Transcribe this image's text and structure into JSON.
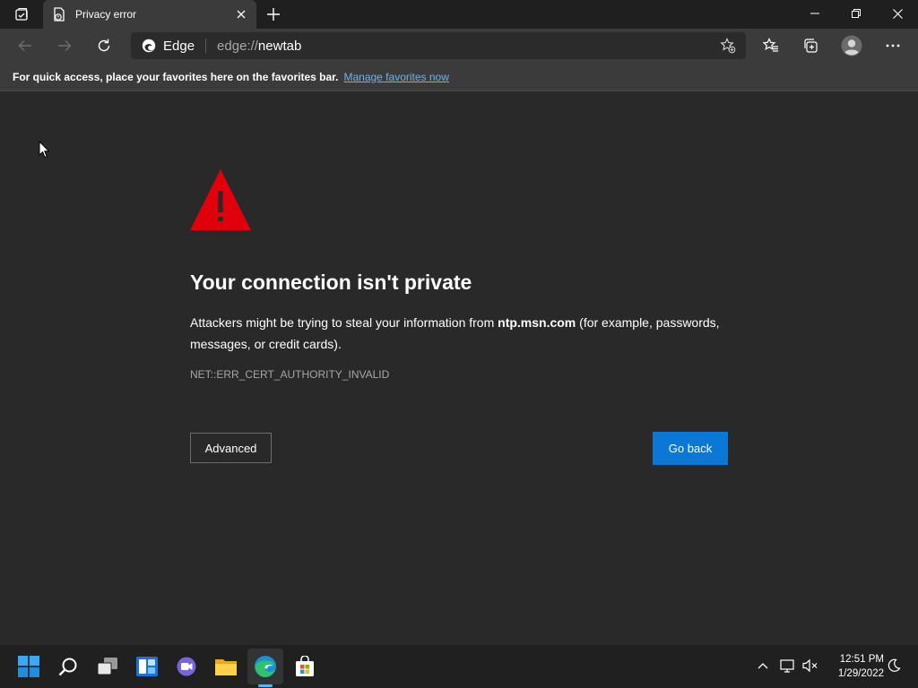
{
  "tab": {
    "title": "Privacy error"
  },
  "address": {
    "brand": "Edge",
    "scheme": "edge://",
    "host": "newtab"
  },
  "favorites_bar": {
    "message": "For quick access, place your favorites here on the favorites bar.",
    "link_label": "Manage favorites now"
  },
  "page": {
    "heading": "Your connection isn't private",
    "desc_prefix": "Attackers might be trying to steal your information from ",
    "desc_host": "ntp.msn.com",
    "desc_suffix": " (for example, passwords, messages, or credit cards).",
    "error_code": "NET::ERR_CERT_AUTHORITY_INVALID",
    "advanced_label": "Advanced",
    "go_back_label": "Go back",
    "warning_color": "#e0000c",
    "button_color": "#0a78d4"
  },
  "taskbar": {
    "apps": [
      "start-icon",
      "search-icon",
      "task-view-icon",
      "widgets-icon",
      "chat-icon",
      "file-explorer-icon",
      "edge-icon",
      "store-icon"
    ],
    "active_app": "edge-icon",
    "tray_icons": [
      "chevron-up-icon",
      "network-icon",
      "volume-muted-icon"
    ],
    "time": "12:51 PM",
    "date": "1/29/2022"
  }
}
